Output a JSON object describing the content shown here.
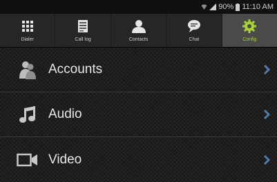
{
  "status_bar": {
    "battery": "90%",
    "time": "11:10 AM",
    "icons": [
      "wifi-icon",
      "signal-icon",
      "battery-icon"
    ]
  },
  "tabs": [
    {
      "label": "Dialer",
      "icon": "dialpad-icon",
      "active": false
    },
    {
      "label": "Call log",
      "icon": "call-log-icon",
      "active": false
    },
    {
      "label": "Contacts",
      "icon": "contacts-icon",
      "active": false
    },
    {
      "label": "Chat",
      "icon": "chat-icon",
      "active": false
    },
    {
      "label": "Config",
      "icon": "gear-icon",
      "active": true
    }
  ],
  "menu": [
    {
      "label": "Accounts",
      "icon": "accounts-icon"
    },
    {
      "label": "Audio",
      "icon": "music-note-icon"
    },
    {
      "label": "Video",
      "icon": "video-camera-icon"
    }
  ],
  "colors": {
    "accent": "#a6d234",
    "chevron": "#4a7fb0",
    "active_tab": "#4a4a4a"
  }
}
